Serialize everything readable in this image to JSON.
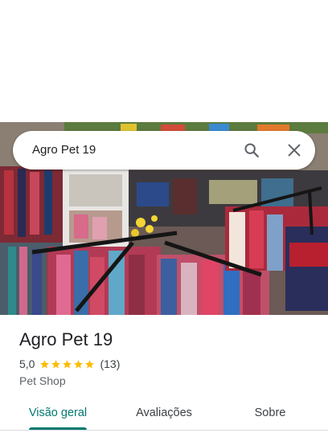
{
  "search": {
    "query": "Agro Pet 19",
    "search_icon": "search-icon",
    "close_icon": "close-icon"
  },
  "place": {
    "name": "Agro Pet 19",
    "rating": "5,0",
    "stars_filled": 5,
    "review_count": "(13)",
    "category": "Pet Shop"
  },
  "tabs": [
    {
      "label": "Visão geral",
      "active": true
    },
    {
      "label": "Avaliações",
      "active": false
    },
    {
      "label": "Sobre",
      "active": false
    }
  ],
  "colors": {
    "accent": "#01796f",
    "star": "#fbbc04",
    "text_primary": "#202124",
    "text_secondary": "#5f6368"
  }
}
